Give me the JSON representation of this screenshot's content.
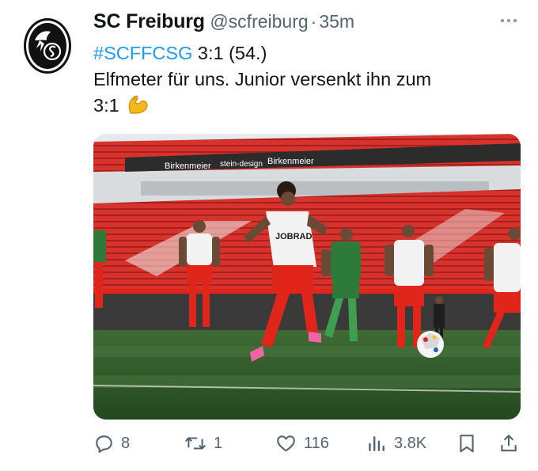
{
  "tweet": {
    "display_name": "SC Freiburg",
    "handle": "@scfreiburg",
    "separator": "·",
    "time": "35m",
    "hashtag": "#SCFFCSG",
    "line1_rest": " 3:1 (54.)",
    "line2": "Elfmeter für uns. Junior versenkt ihn zum",
    "line3": "3:1",
    "emoji": "flexed-biceps-emoji"
  },
  "media": {
    "ad_boards": [
      "Birkenmeier",
      "stein-design",
      "Birkenmeier"
    ],
    "shirt_sponsor": "JOBRAD"
  },
  "actions": {
    "replies": "8",
    "reposts": "1",
    "likes": "116",
    "views": "3.8K"
  },
  "icons": {
    "reply": "reply-icon",
    "repost": "repost-icon",
    "like": "heart-icon",
    "views": "views-icon",
    "bookmark": "bookmark-icon",
    "share": "share-icon",
    "more": "more-icon"
  },
  "colors": {
    "text": "#0f1419",
    "muted": "#536471",
    "link": "#1d9bf0",
    "club_red": "#e0251b"
  }
}
